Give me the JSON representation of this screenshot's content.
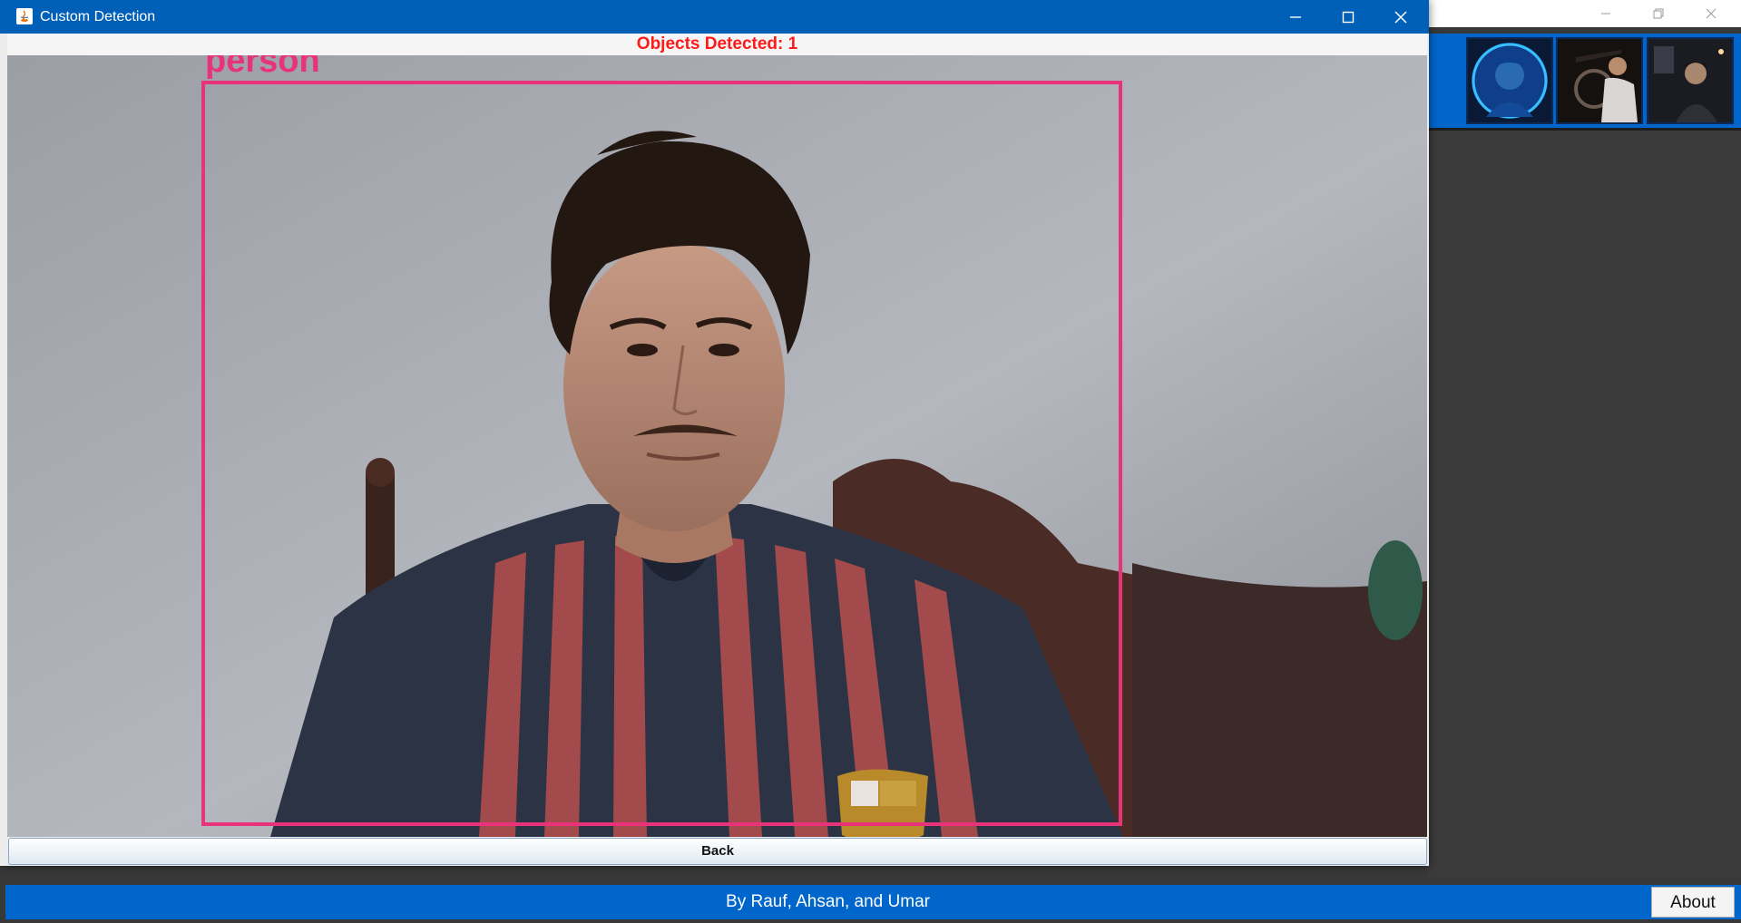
{
  "main_window": {
    "footer_text": "By Rauf, Ahsan, and Umar",
    "about_label": "About",
    "thumbnails": [
      "profile-photo-1",
      "profile-photo-2",
      "profile-photo-3"
    ]
  },
  "dialog": {
    "title": "Custom Detection",
    "status_text": "Objects Detected: 1",
    "detection_label": "person",
    "detection_color": "#e8327a",
    "back_label": "Back"
  },
  "colors": {
    "title_bar": "#0060b8",
    "accent": "#0066cc",
    "status_text": "#ff1a1a"
  }
}
